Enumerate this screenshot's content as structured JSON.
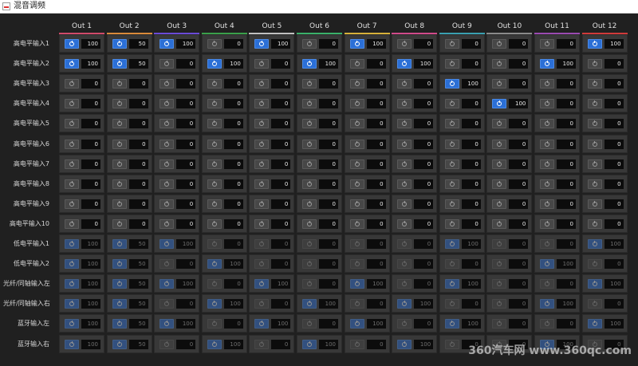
{
  "window": {
    "title": "混音调频"
  },
  "outputs": [
    {
      "label": "Out 1",
      "color": "#d04a6a"
    },
    {
      "label": "Out 2",
      "color": "#d98a3a"
    },
    {
      "label": "Out 3",
      "color": "#6a4ad6"
    },
    {
      "label": "Out 4",
      "color": "#3aa04a"
    },
    {
      "label": "Out 5",
      "color": "#c0c0c0"
    },
    {
      "label": "Out 6",
      "color": "#3ab06a"
    },
    {
      "label": "Out 7",
      "color": "#d6b03a"
    },
    {
      "label": "Out 8",
      "color": "#d04a8a"
    },
    {
      "label": "Out 9",
      "color": "#3aa0b0"
    },
    {
      "label": "Out 10",
      "color": "#8a8a8a"
    },
    {
      "label": "Out 11",
      "color": "#9a4ab0"
    },
    {
      "label": "Out 12",
      "color": "#d03a3a"
    }
  ],
  "inputs": [
    {
      "label": "高电平输入1",
      "dim": false,
      "cells": [
        {
          "on": true,
          "value": "100"
        },
        {
          "on": true,
          "value": "50"
        },
        {
          "on": true,
          "value": "100"
        },
        {
          "on": false,
          "value": "0"
        },
        {
          "on": true,
          "value": "100"
        },
        {
          "on": false,
          "value": "0"
        },
        {
          "on": true,
          "value": "100"
        },
        {
          "on": false,
          "value": "0"
        },
        {
          "on": false,
          "value": "0"
        },
        {
          "on": false,
          "value": "0"
        },
        {
          "on": false,
          "value": "0"
        },
        {
          "on": true,
          "value": "100"
        }
      ]
    },
    {
      "label": "高电平输入2",
      "dim": false,
      "cells": [
        {
          "on": true,
          "value": "100"
        },
        {
          "on": true,
          "value": "50"
        },
        {
          "on": false,
          "value": "0"
        },
        {
          "on": true,
          "value": "100"
        },
        {
          "on": false,
          "value": "0"
        },
        {
          "on": true,
          "value": "100"
        },
        {
          "on": false,
          "value": "0"
        },
        {
          "on": true,
          "value": "100"
        },
        {
          "on": false,
          "value": "0"
        },
        {
          "on": false,
          "value": "0"
        },
        {
          "on": true,
          "value": "100"
        },
        {
          "on": false,
          "value": "0"
        }
      ]
    },
    {
      "label": "高电平输入3",
      "dim": false,
      "cells": [
        {
          "on": false,
          "value": "0"
        },
        {
          "on": false,
          "value": "0"
        },
        {
          "on": false,
          "value": "0"
        },
        {
          "on": false,
          "value": "0"
        },
        {
          "on": false,
          "value": "0"
        },
        {
          "on": false,
          "value": "0"
        },
        {
          "on": false,
          "value": "0"
        },
        {
          "on": false,
          "value": "0"
        },
        {
          "on": true,
          "value": "100"
        },
        {
          "on": false,
          "value": "0"
        },
        {
          "on": false,
          "value": "0"
        },
        {
          "on": false,
          "value": "0"
        }
      ]
    },
    {
      "label": "高电平输入4",
      "dim": false,
      "cells": [
        {
          "on": false,
          "value": "0"
        },
        {
          "on": false,
          "value": "0"
        },
        {
          "on": false,
          "value": "0"
        },
        {
          "on": false,
          "value": "0"
        },
        {
          "on": false,
          "value": "0"
        },
        {
          "on": false,
          "value": "0"
        },
        {
          "on": false,
          "value": "0"
        },
        {
          "on": false,
          "value": "0"
        },
        {
          "on": false,
          "value": "0"
        },
        {
          "on": true,
          "value": "100"
        },
        {
          "on": false,
          "value": "0"
        },
        {
          "on": false,
          "value": "0"
        }
      ]
    },
    {
      "label": "高电平输入5",
      "dim": false,
      "cells": [
        {
          "on": false,
          "value": "0"
        },
        {
          "on": false,
          "value": "0"
        },
        {
          "on": false,
          "value": "0"
        },
        {
          "on": false,
          "value": "0"
        },
        {
          "on": false,
          "value": "0"
        },
        {
          "on": false,
          "value": "0"
        },
        {
          "on": false,
          "value": "0"
        },
        {
          "on": false,
          "value": "0"
        },
        {
          "on": false,
          "value": "0"
        },
        {
          "on": false,
          "value": "0"
        },
        {
          "on": false,
          "value": "0"
        },
        {
          "on": false,
          "value": "0"
        }
      ]
    },
    {
      "label": "高电平输入6",
      "dim": false,
      "cells": [
        {
          "on": false,
          "value": "0"
        },
        {
          "on": false,
          "value": "0"
        },
        {
          "on": false,
          "value": "0"
        },
        {
          "on": false,
          "value": "0"
        },
        {
          "on": false,
          "value": "0"
        },
        {
          "on": false,
          "value": "0"
        },
        {
          "on": false,
          "value": "0"
        },
        {
          "on": false,
          "value": "0"
        },
        {
          "on": false,
          "value": "0"
        },
        {
          "on": false,
          "value": "0"
        },
        {
          "on": false,
          "value": "0"
        },
        {
          "on": false,
          "value": "0"
        }
      ]
    },
    {
      "label": "高电平输入7",
      "dim": false,
      "cells": [
        {
          "on": false,
          "value": "0"
        },
        {
          "on": false,
          "value": "0"
        },
        {
          "on": false,
          "value": "0"
        },
        {
          "on": false,
          "value": "0"
        },
        {
          "on": false,
          "value": "0"
        },
        {
          "on": false,
          "value": "0"
        },
        {
          "on": false,
          "value": "0"
        },
        {
          "on": false,
          "value": "0"
        },
        {
          "on": false,
          "value": "0"
        },
        {
          "on": false,
          "value": "0"
        },
        {
          "on": false,
          "value": "0"
        },
        {
          "on": false,
          "value": "0"
        }
      ]
    },
    {
      "label": "高电平输入8",
      "dim": false,
      "cells": [
        {
          "on": false,
          "value": "0"
        },
        {
          "on": false,
          "value": "0"
        },
        {
          "on": false,
          "value": "0"
        },
        {
          "on": false,
          "value": "0"
        },
        {
          "on": false,
          "value": "0"
        },
        {
          "on": false,
          "value": "0"
        },
        {
          "on": false,
          "value": "0"
        },
        {
          "on": false,
          "value": "0"
        },
        {
          "on": false,
          "value": "0"
        },
        {
          "on": false,
          "value": "0"
        },
        {
          "on": false,
          "value": "0"
        },
        {
          "on": false,
          "value": "0"
        }
      ]
    },
    {
      "label": "高电平输入9",
      "dim": false,
      "cells": [
        {
          "on": false,
          "value": "0"
        },
        {
          "on": false,
          "value": "0"
        },
        {
          "on": false,
          "value": "0"
        },
        {
          "on": false,
          "value": "0"
        },
        {
          "on": false,
          "value": "0"
        },
        {
          "on": false,
          "value": "0"
        },
        {
          "on": false,
          "value": "0"
        },
        {
          "on": false,
          "value": "0"
        },
        {
          "on": false,
          "value": "0"
        },
        {
          "on": false,
          "value": "0"
        },
        {
          "on": false,
          "value": "0"
        },
        {
          "on": false,
          "value": "0"
        }
      ]
    },
    {
      "label": "高电平输入10",
      "dim": false,
      "cells": [
        {
          "on": false,
          "value": "0"
        },
        {
          "on": false,
          "value": "0"
        },
        {
          "on": false,
          "value": "0"
        },
        {
          "on": false,
          "value": "0"
        },
        {
          "on": false,
          "value": "0"
        },
        {
          "on": false,
          "value": "0"
        },
        {
          "on": false,
          "value": "0"
        },
        {
          "on": false,
          "value": "0"
        },
        {
          "on": false,
          "value": "0"
        },
        {
          "on": false,
          "value": "0"
        },
        {
          "on": false,
          "value": "0"
        },
        {
          "on": false,
          "value": "0"
        }
      ]
    },
    {
      "label": "低电平输入1",
      "dim": true,
      "cells": [
        {
          "on": true,
          "value": "100"
        },
        {
          "on": true,
          "value": "50"
        },
        {
          "on": true,
          "value": "100"
        },
        {
          "on": false,
          "value": "0"
        },
        {
          "on": false,
          "value": "0"
        },
        {
          "on": false,
          "value": "0"
        },
        {
          "on": false,
          "value": "0"
        },
        {
          "on": false,
          "value": "0"
        },
        {
          "on": true,
          "value": "100"
        },
        {
          "on": false,
          "value": "0"
        },
        {
          "on": false,
          "value": "0"
        },
        {
          "on": true,
          "value": "100"
        }
      ]
    },
    {
      "label": "低电平输入2",
      "dim": true,
      "cells": [
        {
          "on": true,
          "value": "100"
        },
        {
          "on": true,
          "value": "50"
        },
        {
          "on": false,
          "value": "0"
        },
        {
          "on": true,
          "value": "100"
        },
        {
          "on": false,
          "value": "0"
        },
        {
          "on": false,
          "value": "0"
        },
        {
          "on": false,
          "value": "0"
        },
        {
          "on": false,
          "value": "0"
        },
        {
          "on": false,
          "value": "0"
        },
        {
          "on": false,
          "value": "0"
        },
        {
          "on": true,
          "value": "100"
        },
        {
          "on": false,
          "value": "0"
        }
      ]
    },
    {
      "label": "光纤/同轴输入左",
      "dim": true,
      "cells": [
        {
          "on": true,
          "value": "100"
        },
        {
          "on": true,
          "value": "50"
        },
        {
          "on": true,
          "value": "100"
        },
        {
          "on": false,
          "value": "0"
        },
        {
          "on": true,
          "value": "100"
        },
        {
          "on": false,
          "value": "0"
        },
        {
          "on": true,
          "value": "100"
        },
        {
          "on": false,
          "value": "0"
        },
        {
          "on": true,
          "value": "100"
        },
        {
          "on": false,
          "value": "0"
        },
        {
          "on": false,
          "value": "0"
        },
        {
          "on": true,
          "value": "100"
        }
      ]
    },
    {
      "label": "光纤/同轴输入右",
      "dim": true,
      "cells": [
        {
          "on": true,
          "value": "100"
        },
        {
          "on": true,
          "value": "50"
        },
        {
          "on": false,
          "value": "0"
        },
        {
          "on": true,
          "value": "100"
        },
        {
          "on": false,
          "value": "0"
        },
        {
          "on": true,
          "value": "100"
        },
        {
          "on": false,
          "value": "0"
        },
        {
          "on": true,
          "value": "100"
        },
        {
          "on": false,
          "value": "0"
        },
        {
          "on": false,
          "value": "0"
        },
        {
          "on": true,
          "value": "100"
        },
        {
          "on": false,
          "value": "0"
        }
      ]
    },
    {
      "label": "蓝牙输入左",
      "dim": true,
      "cells": [
        {
          "on": true,
          "value": "100"
        },
        {
          "on": true,
          "value": "50"
        },
        {
          "on": true,
          "value": "100"
        },
        {
          "on": false,
          "value": "0"
        },
        {
          "on": true,
          "value": "100"
        },
        {
          "on": false,
          "value": "0"
        },
        {
          "on": true,
          "value": "100"
        },
        {
          "on": false,
          "value": "0"
        },
        {
          "on": true,
          "value": "100"
        },
        {
          "on": false,
          "value": "0"
        },
        {
          "on": false,
          "value": "0"
        },
        {
          "on": true,
          "value": "100"
        }
      ]
    },
    {
      "label": "蓝牙输入右",
      "dim": true,
      "cells": [
        {
          "on": true,
          "value": "100"
        },
        {
          "on": true,
          "value": "50"
        },
        {
          "on": false,
          "value": "0"
        },
        {
          "on": true,
          "value": "100"
        },
        {
          "on": false,
          "value": "0"
        },
        {
          "on": true,
          "value": "100"
        },
        {
          "on": false,
          "value": "0"
        },
        {
          "on": true,
          "value": "100"
        },
        {
          "on": false,
          "value": "0"
        },
        {
          "on": false,
          "value": "0"
        },
        {
          "on": true,
          "value": "100"
        },
        {
          "on": false,
          "value": "0"
        }
      ]
    }
  ],
  "watermark": "360汽车网 www.360qc.com"
}
